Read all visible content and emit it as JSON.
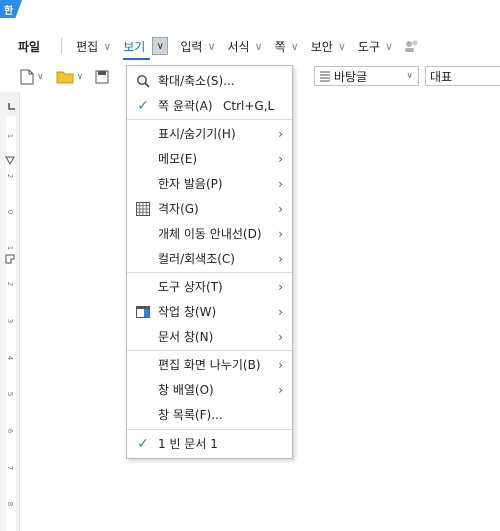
{
  "app": {
    "badge": "한"
  },
  "menubar": {
    "items": [
      {
        "label": "파일",
        "has_chevron": false
      },
      {
        "label": "편집",
        "has_chevron": true
      },
      {
        "label": "보기",
        "has_chevron": true,
        "active": true
      },
      {
        "label": "입력",
        "has_chevron": true
      },
      {
        "label": "서식",
        "has_chevron": true
      },
      {
        "label": "쪽",
        "has_chevron": true
      },
      {
        "label": "보안",
        "has_chevron": true
      },
      {
        "label": "도구",
        "has_chevron": true
      }
    ],
    "chevron": "∨"
  },
  "toolbar": {
    "style_value": "바탕글",
    "font_value": "대표"
  },
  "ruler": {
    "labels": [
      "1",
      "2",
      "0",
      "1",
      "2",
      "3",
      "4",
      "5",
      "6",
      "7",
      "8"
    ]
  },
  "view_menu": {
    "items": [
      {
        "label": "확대/축소(S)...",
        "icon": "magnifier-icon"
      },
      {
        "label": "쪽 윤곽(A)",
        "shortcut": "Ctrl+G,L",
        "icon": "check-icon"
      },
      {
        "label": "표시/숨기기(H)",
        "submenu": true
      },
      {
        "label": "메모(E)",
        "submenu": true
      },
      {
        "label": "한자 발음(P)",
        "submenu": true
      },
      {
        "label": "격자(G)",
        "submenu": true,
        "icon": "grid-icon"
      },
      {
        "label": "개체 이동 안내선(D)",
        "submenu": true
      },
      {
        "label": "컬러/회색조(C)",
        "submenu": true
      },
      {
        "label": "도구 상자(T)",
        "submenu": true
      },
      {
        "label": "작업 창(W)",
        "submenu": true,
        "icon": "task-pane-icon"
      },
      {
        "label": "문서 창(N)",
        "submenu": true
      },
      {
        "label": "편집 화면 나누기(B)",
        "submenu": true
      },
      {
        "label": "창 배열(O)",
        "submenu": true
      },
      {
        "label": "창 목록(F)..."
      },
      {
        "label": "1 빈 문서 1",
        "icon": "check-icon"
      }
    ],
    "submenu_arrow": "›",
    "check_glyph": "✓"
  }
}
